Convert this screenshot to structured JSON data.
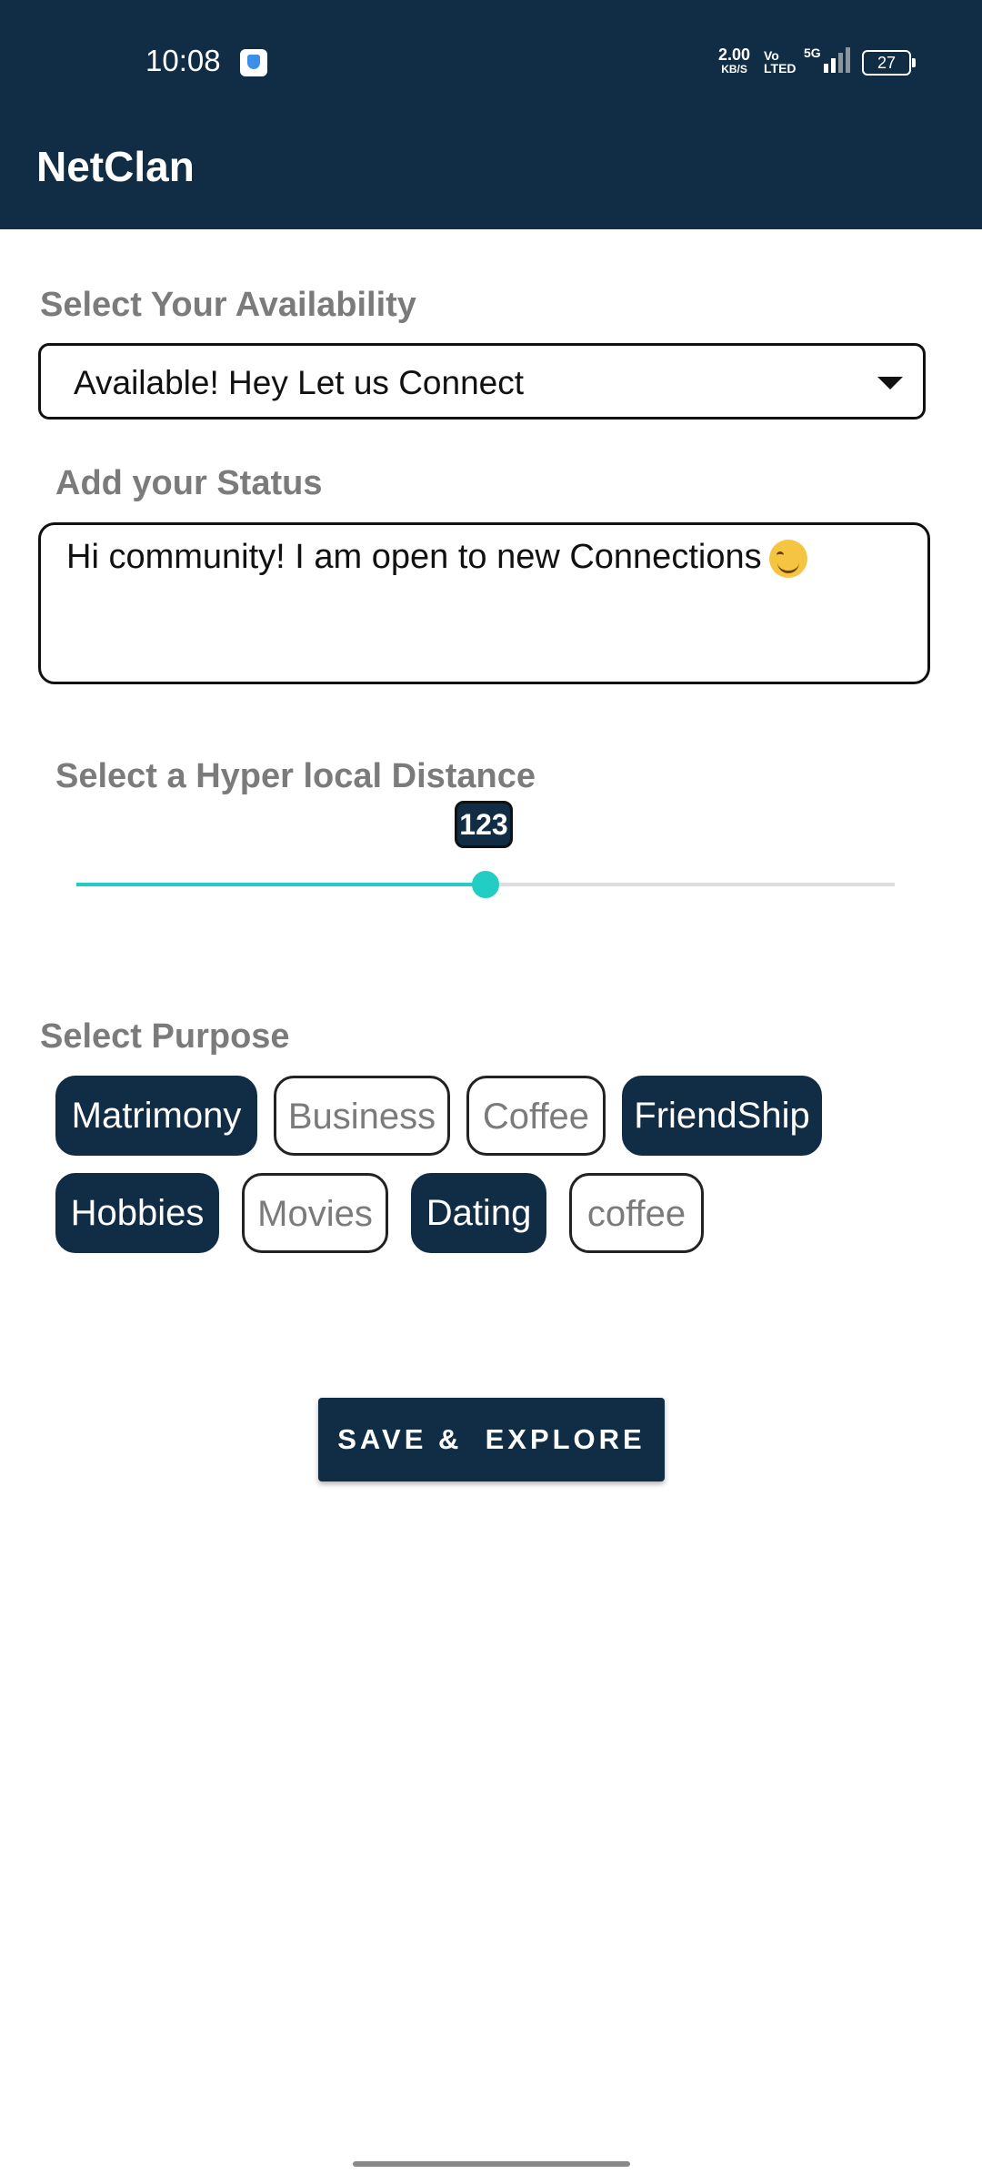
{
  "status_bar": {
    "time": "10:08",
    "net_speed": "2.00",
    "net_speed_unit": "KB/S",
    "volte": "Vo LTED",
    "network": "5G",
    "battery": "27"
  },
  "app_bar": {
    "title": "NetClan"
  },
  "availability": {
    "label": "Select Your Availability",
    "selected": "Available! Hey Let us Connect"
  },
  "status": {
    "label": "Add your Status",
    "value": "Hi community! I am open to new Connections"
  },
  "distance": {
    "label": "Select a Hyper local Distance",
    "value": "123",
    "fraction": 0.5
  },
  "purpose": {
    "label": "Select Purpose",
    "chips": [
      {
        "label": "Matrimony",
        "selected": true
      },
      {
        "label": "Business",
        "selected": false
      },
      {
        "label": "Coffee",
        "selected": false
      },
      {
        "label": "FriendShip",
        "selected": true
      },
      {
        "label": "Hobbies",
        "selected": true
      },
      {
        "label": "Movies",
        "selected": false
      },
      {
        "label": "Dating",
        "selected": true
      },
      {
        "label": "coffee",
        "selected": false
      }
    ]
  },
  "save_button": {
    "label": "SAVE &  EXPLORE"
  },
  "colors": {
    "primary": "#112d45",
    "accent": "#22cec4",
    "label_gray": "#7b7b7b"
  }
}
